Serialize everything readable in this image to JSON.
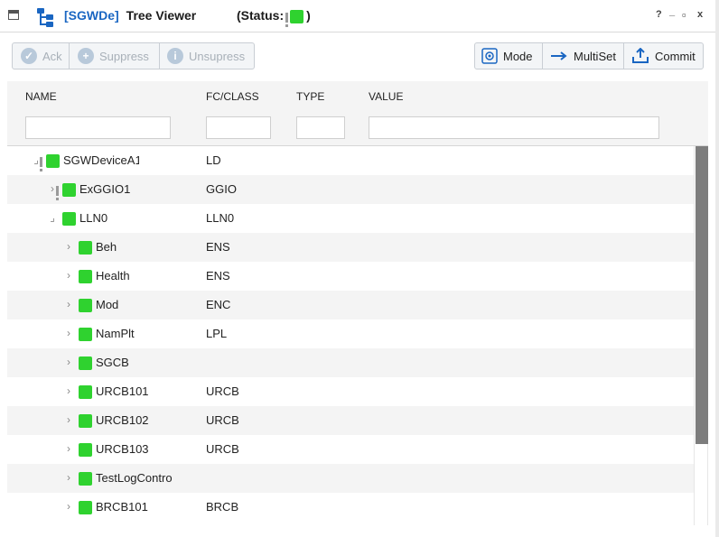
{
  "window": {
    "device": "[SGWDe]",
    "title": "Tree Viewer",
    "status_label": "(Status:",
    "status_close": ")",
    "help": "?",
    "minimize": "_",
    "maximize": "▫",
    "close": "x"
  },
  "toolbar": {
    "ack": "Ack",
    "suppress": "Suppress",
    "unsuppress": "Unsupress",
    "mode": "Mode",
    "multiset": "MultiSet",
    "commit": "Commit"
  },
  "columns": {
    "name": "NAME",
    "fc_class": "FC/CLASS",
    "type": "TYPE",
    "value": "VALUE"
  },
  "filters": {
    "name": "",
    "fc_class": "",
    "type": "",
    "value": ""
  },
  "colors": {
    "status_ok": "#2fd22f",
    "accent": "#1a66c2"
  },
  "rows": [
    {
      "name": "SGWDeviceA1",
      "fc": "LD",
      "depth": 0,
      "expanded": true,
      "flag": true
    },
    {
      "name": "ExGGIO1",
      "fc": "GGIO",
      "depth": 1,
      "expanded": false,
      "flag": true
    },
    {
      "name": "LLN0",
      "fc": "LLN0",
      "depth": 1,
      "expanded": true,
      "flag": false
    },
    {
      "name": "Beh",
      "fc": "ENS",
      "depth": 2,
      "expanded": false,
      "flag": false
    },
    {
      "name": "Health",
      "fc": "ENS",
      "depth": 2,
      "expanded": false,
      "flag": false
    },
    {
      "name": "Mod",
      "fc": "ENC",
      "depth": 2,
      "expanded": false,
      "flag": false
    },
    {
      "name": "NamPlt",
      "fc": "LPL",
      "depth": 2,
      "expanded": false,
      "flag": false
    },
    {
      "name": "SGCB",
      "fc": "",
      "depth": 2,
      "expanded": false,
      "flag": false
    },
    {
      "name": "URCB101",
      "fc": "URCB",
      "depth": 2,
      "expanded": false,
      "flag": false
    },
    {
      "name": "URCB102",
      "fc": "URCB",
      "depth": 2,
      "expanded": false,
      "flag": false
    },
    {
      "name": "URCB103",
      "fc": "URCB",
      "depth": 2,
      "expanded": false,
      "flag": false
    },
    {
      "name": "TestLogControl",
      "fc": "",
      "depth": 2,
      "expanded": false,
      "flag": false
    },
    {
      "name": "BRCB101",
      "fc": "BRCB",
      "depth": 2,
      "expanded": false,
      "flag": false
    }
  ]
}
